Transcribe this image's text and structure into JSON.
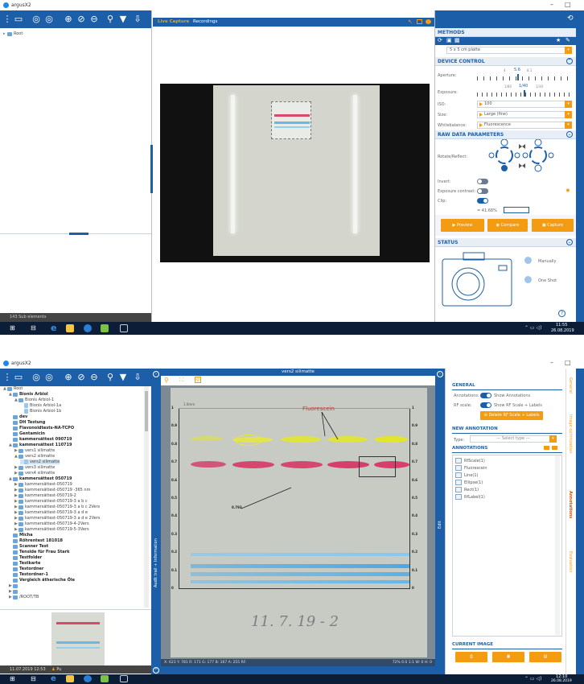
{
  "app": {
    "title": "argusX2"
  },
  "top": {
    "tabs": [
      {
        "label": "Live Capture"
      },
      {
        "label": "Recordings"
      }
    ],
    "left_tree": [
      {
        "label": "Root"
      }
    ],
    "status_left": "143 Sub elements",
    "methods": {
      "header": "METHODS",
      "method_value": "5 x 5 cm platte"
    },
    "device_control": {
      "header": "DEVICE CONTROL",
      "aperture_label": "Aperture:",
      "aperture_ticks": [
        "4",
        "5.6",
        "8.1"
      ],
      "exposure_label": "Exposure:",
      "exposure_ticks": [
        "1/80",
        "1/40",
        "1/30"
      ],
      "iso_label": "ISO:",
      "iso_value": "100",
      "size_label": "Size:",
      "size_value": "Large (fine)",
      "wb_label": "Whitebalance:",
      "wb_value": "Fluorescence"
    },
    "raw": {
      "header": "RAW DATA PARAMETERS",
      "rotate_label": "Rotate/Reflect:",
      "invert_label": "Invert:",
      "contrast_label": "Exposure contrast:",
      "clip_label": "Clip:",
      "clip_value": "= 41.68%"
    },
    "buttons": {
      "preview": "Preview",
      "compare": "Compare",
      "capture": "Capture"
    },
    "status": {
      "header": "STATUS",
      "manually": "Manually",
      "oneshot": "One Shot"
    },
    "taskbar": {
      "time": "11:55",
      "date": "26.08.2019"
    }
  },
  "bottom": {
    "window_title": "vers2 silimatte",
    "tree": [
      {
        "label": "Root",
        "indent": 0,
        "bold": false,
        "icon": "folder",
        "tw": "▲"
      },
      {
        "label": "Bionis Arbiol",
        "indent": 1,
        "bold": true,
        "icon": "folder",
        "tw": "▲"
      },
      {
        "label": "Bionis Arbiol-1",
        "indent": 2,
        "bold": false,
        "icon": "folder",
        "tw": "▲"
      },
      {
        "label": "Bionis Arbiol-1a",
        "indent": 3,
        "bold": false,
        "icon": "doc",
        "tw": ""
      },
      {
        "label": "Bionis Arbiol-1b",
        "indent": 3,
        "bold": false,
        "icon": "doc",
        "tw": ""
      },
      {
        "label": "dev",
        "indent": 1,
        "bold": true,
        "icon": "folder",
        "tw": ""
      },
      {
        "label": "DH Testung",
        "indent": 1,
        "bold": true,
        "icon": "folder",
        "tw": ""
      },
      {
        "label": "Flavonoidtests-NA-TCPO",
        "indent": 1,
        "bold": true,
        "icon": "folder",
        "tw": ""
      },
      {
        "label": "Gentamicin",
        "indent": 1,
        "bold": true,
        "icon": "folder",
        "tw": ""
      },
      {
        "label": "kammersättest 090719",
        "indent": 1,
        "bold": true,
        "icon": "folder",
        "tw": ""
      },
      {
        "label": "kammersättest 110719",
        "indent": 1,
        "bold": true,
        "icon": "folder",
        "tw": "▲"
      },
      {
        "label": "vers1 silimatte",
        "indent": 2,
        "bold": false,
        "icon": "folder",
        "tw": "▶"
      },
      {
        "label": "vers2 silimatte",
        "indent": 2,
        "bold": false,
        "icon": "folder",
        "tw": "▲"
      },
      {
        "label": "vers2 silimatte",
        "indent": 3,
        "bold": false,
        "icon": "doc",
        "tw": "",
        "selected": true
      },
      {
        "label": "vers3 silimatte",
        "indent": 2,
        "bold": false,
        "icon": "folder",
        "tw": "▶"
      },
      {
        "label": "vers4 silimatte",
        "indent": 2,
        "bold": false,
        "icon": "folder",
        "tw": "▶"
      },
      {
        "label": "kammersättest 050719",
        "indent": 1,
        "bold": true,
        "icon": "folder",
        "tw": "▲"
      },
      {
        "label": "kammersättest-050719",
        "indent": 2,
        "bold": false,
        "icon": "folder",
        "tw": "▶"
      },
      {
        "label": "kammersättest-050719 -365 nm",
        "indent": 2,
        "bold": false,
        "icon": "folder",
        "tw": "▶"
      },
      {
        "label": "kammersättest-050719-2",
        "indent": 2,
        "bold": false,
        "icon": "folder",
        "tw": "▶"
      },
      {
        "label": "kammersättest-050719-3 a b c",
        "indent": 2,
        "bold": false,
        "icon": "folder",
        "tw": "▶"
      },
      {
        "label": "kammersättest-050719-3 a b c 2Vers",
        "indent": 2,
        "bold": false,
        "icon": "folder",
        "tw": "▶"
      },
      {
        "label": "kammersättest-050719-3 a d e",
        "indent": 2,
        "bold": false,
        "icon": "folder",
        "tw": "▶"
      },
      {
        "label": "kammersättest-050719-3 a d e 2Vers",
        "indent": 2,
        "bold": false,
        "icon": "folder",
        "tw": "▶"
      },
      {
        "label": "kammersättest-050719-4-2Vers",
        "indent": 2,
        "bold": false,
        "icon": "folder",
        "tw": "▶"
      },
      {
        "label": "kammersättest-050719-5-3Vers",
        "indent": 2,
        "bold": false,
        "icon": "folder",
        "tw": "▶"
      },
      {
        "label": "Micha",
        "indent": 1,
        "bold": true,
        "icon": "folder",
        "tw": ""
      },
      {
        "label": "Röhrentest 181018",
        "indent": 1,
        "bold": true,
        "icon": "folder",
        "tw": ""
      },
      {
        "label": "Scanner Test",
        "indent": 1,
        "bold": true,
        "icon": "folder",
        "tw": ""
      },
      {
        "label": "Tenside für Frau Stark",
        "indent": 1,
        "bold": true,
        "icon": "folder",
        "tw": ""
      },
      {
        "label": "Testfolder",
        "indent": 1,
        "bold": true,
        "icon": "folder",
        "tw": ""
      },
      {
        "label": "Testkarte",
        "indent": 1,
        "bold": true,
        "icon": "folder",
        "tw": ""
      },
      {
        "label": "Testordner",
        "indent": 1,
        "bold": true,
        "icon": "folder",
        "tw": ""
      },
      {
        "label": "Testordner-1",
        "indent": 1,
        "bold": true,
        "icon": "folder",
        "tw": ""
      },
      {
        "label": "Vergleich ätherische Öle",
        "indent": 1,
        "bold": true,
        "icon": "folder",
        "tw": ""
      },
      {
        "label": "",
        "indent": 1,
        "bold": false,
        "icon": "folder",
        "tw": "▶"
      },
      {
        "label": "",
        "indent": 1,
        "bold": false,
        "icon": "folder",
        "tw": "▶"
      },
      {
        "label": "/ROOT/TB",
        "indent": 1,
        "bold": false,
        "icon": "folder",
        "tw": "▶"
      }
    ],
    "status_left": "11.07.2019 12:53",
    "status_user": "Pu",
    "side_tab": "Audit trail + Information",
    "edit_tab": "Edit",
    "plate": {
      "label_fluorescein": "Fluorescein",
      "rf_marker": "0.793",
      "top_label": "1.0mm",
      "handwriting": "11. 7. 19 - 2",
      "rf_ticks": [
        "1",
        "0.9",
        "0.8",
        "0.7",
        "0.6",
        "0.5",
        "0.4",
        "0.3",
        "0.2",
        "0.1",
        "0"
      ]
    },
    "image_status": "X: 623 Y: 781   R: 171 G: 177 B: 167 A: 255   RF:",
    "image_status_right": "72%   0.0   1:1   W: 0 H: 0",
    "general": {
      "header": "GENERAL",
      "annotations_label": "Annotations:",
      "annotations_value": "Show Annotations",
      "rfscale_label": "RF scale:",
      "rfscale_value": "Show RF Scale + Labels",
      "delete_btn": "Delete RF Scale + Labels"
    },
    "new_annotation": {
      "header": "NEW ANNOTATION",
      "type_label": "Type:",
      "type_placeholder": "--- Select type ---"
    },
    "annotations": {
      "header": "ANNOTATIONS",
      "items": [
        {
          "label": "RfScale(1)"
        },
        {
          "label": "Fluorescein"
        },
        {
          "label": "Line(1)"
        },
        {
          "label": "Ellipse(1)"
        },
        {
          "label": "Rect(1)"
        },
        {
          "label": "RfLabel(1)"
        }
      ]
    },
    "right_tabs": [
      "General",
      "Image optimization",
      "Annotations",
      "Evaluation"
    ],
    "current_image": {
      "header": "CURRENT IMAGE"
    },
    "taskbar": {
      "time": "12:10",
      "date": "26.08.2019"
    }
  },
  "colors": {
    "brand_blue": "#1c5fa8",
    "accent_orange": "#f39c12"
  }
}
